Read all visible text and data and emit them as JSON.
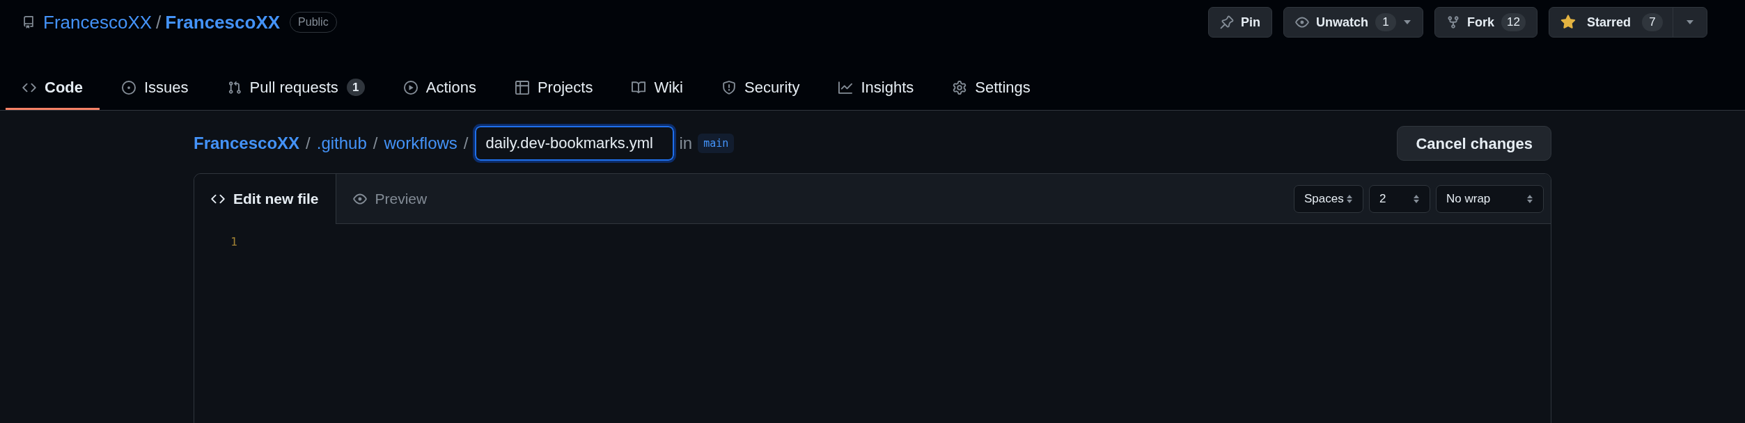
{
  "repo": {
    "owner": "FrancescoXX",
    "name": "FrancescoXX",
    "visibility": "Public"
  },
  "repo_actions": [
    {
      "kind": "pin",
      "label": "Pin"
    },
    {
      "kind": "watch",
      "label": "Unwatch",
      "count": "1"
    },
    {
      "kind": "fork",
      "label": "Fork",
      "count": "12"
    },
    {
      "kind": "star",
      "label": "Starred",
      "count": "7",
      "starred": true
    }
  ],
  "nav_tabs": [
    {
      "label": "Code",
      "selected": true
    },
    {
      "label": "Issues",
      "selected": false
    },
    {
      "label": "Pull requests",
      "counter": "1",
      "selected": false
    },
    {
      "label": "Actions",
      "selected": false
    },
    {
      "label": "Projects",
      "selected": false
    },
    {
      "label": "Wiki",
      "selected": false
    },
    {
      "label": "Security",
      "selected": false
    },
    {
      "label": "Insights",
      "selected": false
    },
    {
      "label": "Settings",
      "selected": false
    }
  ],
  "breadcrumb": {
    "segments": [
      "FrancescoXX",
      ".github",
      "workflows"
    ],
    "separator": "/",
    "filename": "daily.dev-bookmarks.yml",
    "in_label": "in",
    "branch": "main"
  },
  "cancel_button": "Cancel changes",
  "editor": {
    "tabs": [
      {
        "label": "Edit new file",
        "selected": true
      },
      {
        "label": "Preview",
        "selected": false
      }
    ],
    "options": [
      "Spaces",
      "2",
      "No wrap"
    ],
    "line_numbers": [
      "1"
    ]
  }
}
